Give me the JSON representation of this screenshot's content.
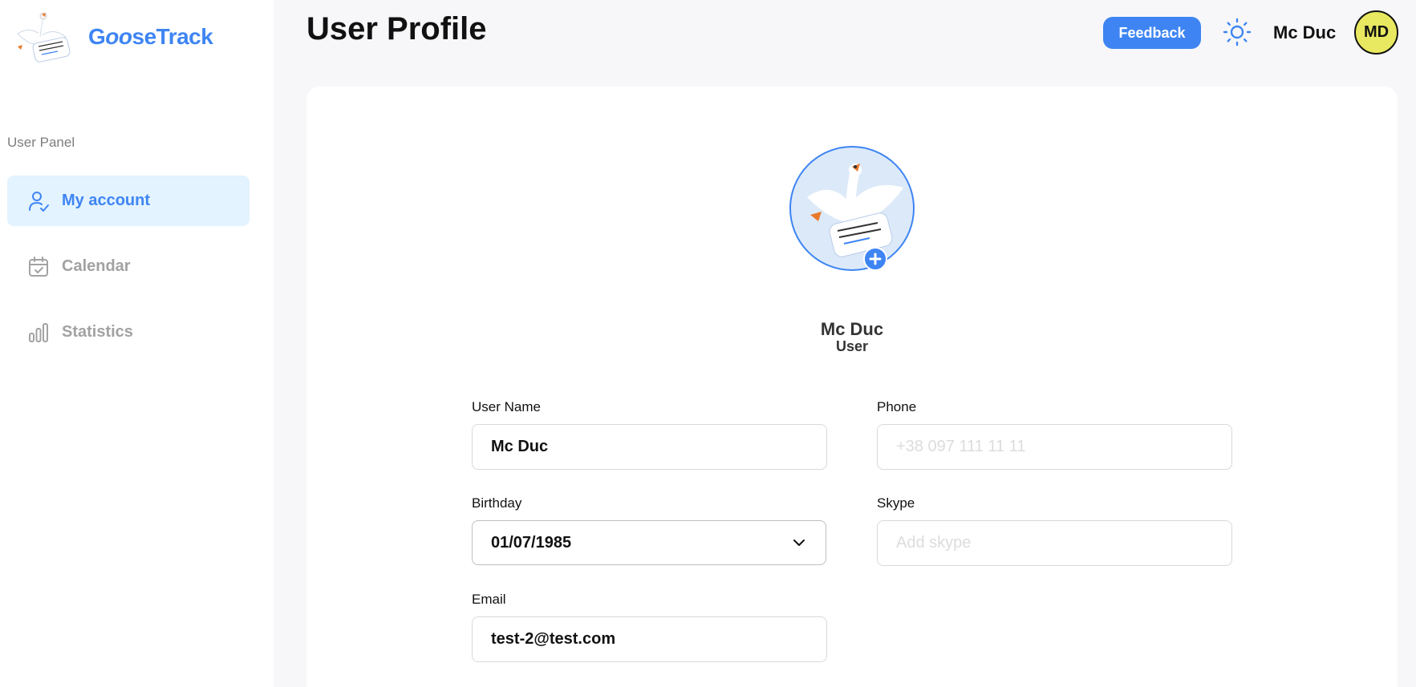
{
  "brand": {
    "name_part1": "G",
    "name_part2": "oo",
    "name_part3": "seTrack",
    "logo_icon": "goose-logo-icon"
  },
  "sidebar": {
    "panel_label": "User Panel",
    "items": [
      {
        "label": "My account",
        "icon": "user-check-icon",
        "active": true
      },
      {
        "label": "Calendar",
        "icon": "calendar-check-icon",
        "active": false
      },
      {
        "label": "Statistics",
        "icon": "bar-chart-icon",
        "active": false
      }
    ]
  },
  "header": {
    "title": "User Profile",
    "feedback_label": "Feedback",
    "theme_icon": "sun-icon",
    "user_name": "Mc Duc",
    "avatar_initials": "MD"
  },
  "profile": {
    "name": "Mc Duc",
    "role": "User",
    "avatar_icon": "goose-avatar-icon",
    "add_icon": "plus-icon"
  },
  "form": {
    "user_name": {
      "label": "User Name",
      "value": "Mc Duc",
      "placeholder": ""
    },
    "phone": {
      "label": "Phone",
      "value": "",
      "placeholder": "+38 097 111 11 11"
    },
    "birthday": {
      "label": "Birthday",
      "value": "01/07/1985"
    },
    "skype": {
      "label": "Skype",
      "value": "",
      "placeholder": "Add skype"
    },
    "email": {
      "label": "Email",
      "value": "test-2@test.com",
      "placeholder": ""
    }
  },
  "colors": {
    "accent": "#3e85f3",
    "active_bg": "#e3f3ff",
    "avatar_bg": "#e8e861",
    "page_bg": "#f7f7f9"
  }
}
